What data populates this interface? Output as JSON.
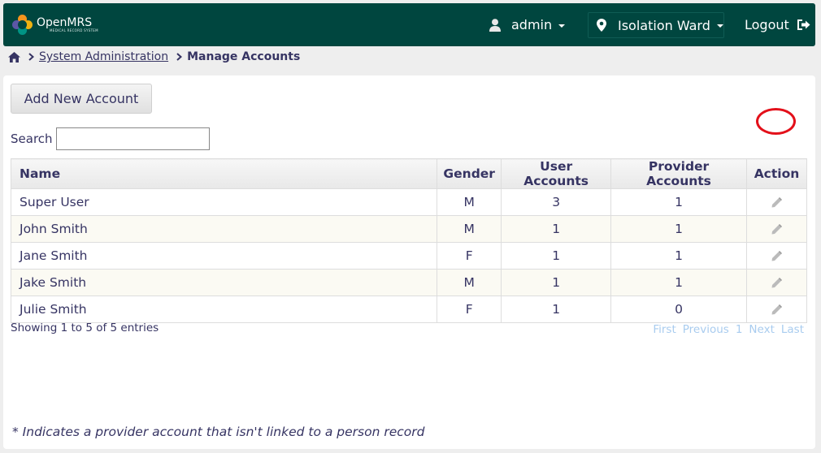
{
  "header": {
    "logo_name": "OpenMRS",
    "logo_tagline": "MEDICAL RECORD SYSTEM",
    "user": "admin",
    "location": "Isolation Ward",
    "logout": "Logout"
  },
  "breadcrumb": {
    "parent": "System Administration",
    "current": "Manage Accounts"
  },
  "add_button": "Add New Account",
  "search": {
    "label": "Search",
    "value": ""
  },
  "table": {
    "headers": [
      "Name",
      "Gender",
      "User Accounts",
      "Provider Accounts",
      "Action"
    ],
    "rows": [
      {
        "name": "Super User",
        "gender": "M",
        "user_accounts": "3",
        "provider_accounts": "1"
      },
      {
        "name": "John Smith",
        "gender": "M",
        "user_accounts": "1",
        "provider_accounts": "1"
      },
      {
        "name": "Jane Smith",
        "gender": "F",
        "user_accounts": "1",
        "provider_accounts": "1"
      },
      {
        "name": "Jake Smith",
        "gender": "M",
        "user_accounts": "1",
        "provider_accounts": "1"
      },
      {
        "name": "Julie Smith",
        "gender": "F",
        "user_accounts": "1",
        "provider_accounts": "0"
      }
    ]
  },
  "info": "Showing 1 to 5 of 5 entries",
  "pager": {
    "first": "First",
    "previous": "Previous",
    "page": "1",
    "next": "Next",
    "last": "Last"
  },
  "footnote": "* Indicates a provider account that isn't linked to a person record",
  "colors": {
    "header_bg": "#00463f",
    "text": "#363463",
    "highlight": "#e3101a",
    "pager_disabled": "#a9ccef"
  }
}
